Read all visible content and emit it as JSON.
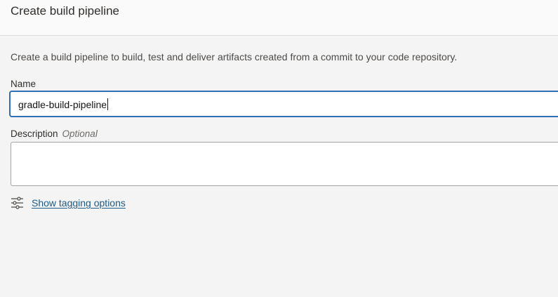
{
  "header": {
    "title": "Create build pipeline"
  },
  "form": {
    "intro": "Create a build pipeline to build, test and deliver artifacts created from a commit to your code repository.",
    "name": {
      "label": "Name",
      "value": "gradle-build-pipeline"
    },
    "description": {
      "label": "Description",
      "optional_label": "Optional",
      "value": ""
    },
    "tagging": {
      "icon": "sliders-icon",
      "link_label": "Show tagging options"
    }
  },
  "colors": {
    "focus_border": "#2e6fb3",
    "link": "#1b5a8a",
    "background": "#f4f4f4"
  }
}
